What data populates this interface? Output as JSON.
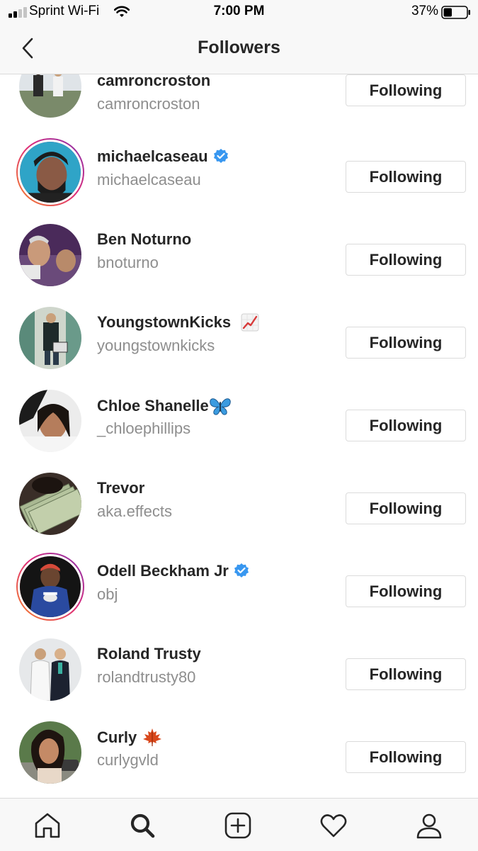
{
  "status_bar": {
    "carrier": "Sprint Wi-Fi",
    "time": "7:00 PM",
    "battery": "37%",
    "battery_level": 0.37
  },
  "header": {
    "title": "Followers",
    "back_icon": "chevron-left-icon"
  },
  "followers": [
    {
      "name": "camroncroston",
      "handle": "camroncroston",
      "button": "Following",
      "verified": false,
      "emoji": "",
      "story_ring": false
    },
    {
      "name": "michaelcaseau",
      "handle": "michaelcaseau",
      "button": "Following",
      "verified": true,
      "emoji": "",
      "story_ring": true
    },
    {
      "name": "Ben Noturno",
      "handle": "bnoturno",
      "button": "Following",
      "verified": false,
      "emoji": "",
      "story_ring": false
    },
    {
      "name": "YoungstownKicks",
      "handle": "youngstownkicks",
      "button": "Following",
      "verified": false,
      "emoji": "chart-increasing-emoji",
      "story_ring": false
    },
    {
      "name": "Chloe Shanelle",
      "handle": "_chloephillips",
      "button": "Following",
      "verified": false,
      "emoji": "butterfly-emoji",
      "story_ring": false
    },
    {
      "name": "Trevor",
      "handle": "aka.effects",
      "button": "Following",
      "verified": false,
      "emoji": "",
      "story_ring": false
    },
    {
      "name": "Odell Beckham Jr",
      "handle": "obj",
      "button": "Following",
      "verified": true,
      "emoji": "",
      "story_ring": true
    },
    {
      "name": "Roland Trusty",
      "handle": "rolandtrusty80",
      "button": "Following",
      "verified": false,
      "emoji": "",
      "story_ring": false
    },
    {
      "name": "Curly",
      "handle": "curlygvld",
      "button": "Following",
      "verified": false,
      "emoji": "maple-leaf-emoji",
      "story_ring": false
    }
  ],
  "tab_bar": {
    "items": [
      "home-icon",
      "search-icon",
      "new-post-icon",
      "activity-heart-icon",
      "profile-icon"
    ],
    "active": "search-icon"
  },
  "colors": {
    "verified_blue": "#3897f0",
    "secondary_text": "#8e8e8e",
    "border": "#dbdbdb"
  }
}
